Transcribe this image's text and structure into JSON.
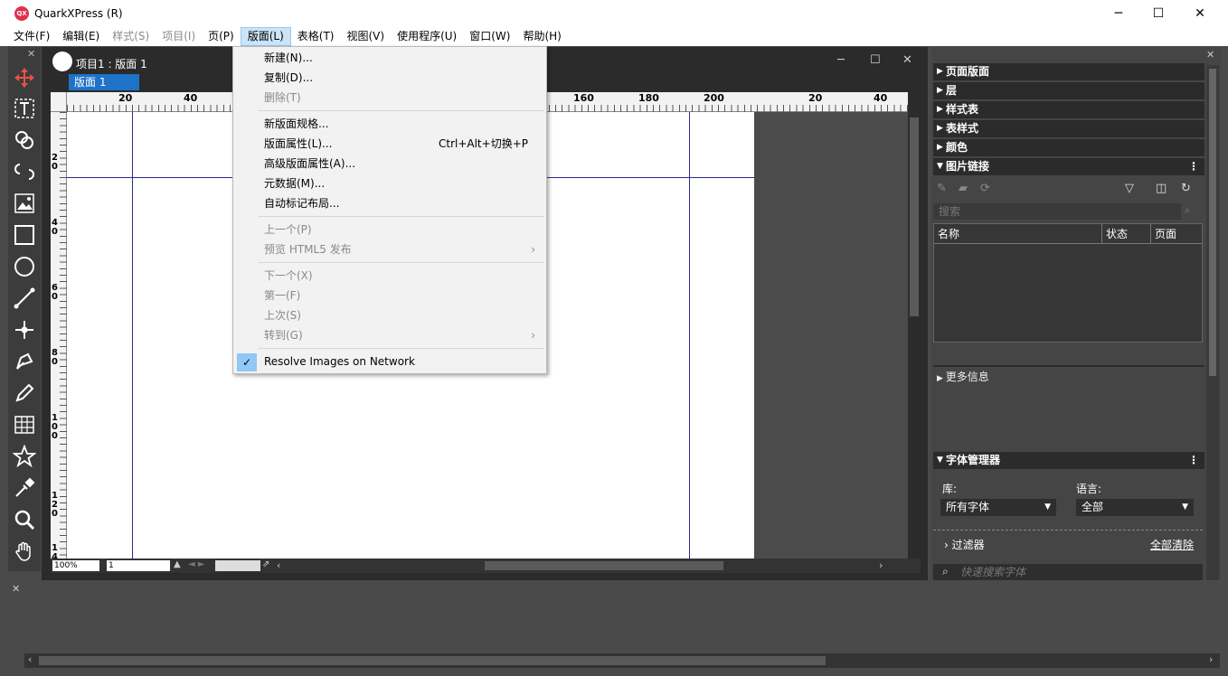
{
  "window": {
    "app_icon_text": "QX",
    "title": "QuarkXPress (R)",
    "minimize": "─",
    "maximize": "☐",
    "close": "✕"
  },
  "menubar": [
    "文件(F)",
    "编辑(E)",
    "样式(S)",
    "项目(I)",
    "页(P)",
    "版面(L)",
    "表格(T)",
    "视图(V)",
    "使用程序(U)",
    "窗口(W)",
    "帮助(H)"
  ],
  "menubar_disabled": [
    2,
    3
  ],
  "menubar_active": 5,
  "document": {
    "title": "项目1 : 版面 1",
    "layout_tab": "版面 1",
    "ruler_top_labels": [
      "20",
      "40",
      "160",
      "180",
      "200",
      "20",
      "40"
    ],
    "ruler_left_labels": [
      "2\n0",
      "4\n0",
      "6\n0",
      "8\n0",
      "1\n0\n0",
      "1\n2\n0",
      "1\n4"
    ],
    "zoom": "100%",
    "page_number": "1"
  },
  "dropdown": {
    "items": [
      {
        "label": "新建(N)...",
        "enabled": true
      },
      {
        "label": "复制(D)...",
        "enabled": true
      },
      {
        "label": "删除(T)",
        "enabled": false
      },
      {
        "label": "新版面规格...",
        "enabled": true
      },
      {
        "label": "版面属性(L)...",
        "enabled": true,
        "shortcut": "Ctrl+Alt+切换+P"
      },
      {
        "label": "高级版面属性(A)...",
        "enabled": true
      },
      {
        "label": "元数据(M)...",
        "enabled": true
      },
      {
        "label": "自动标记布局...",
        "enabled": true
      },
      {
        "label": "上一个(P)",
        "enabled": false
      },
      {
        "label": "预览 HTML5 发布",
        "enabled": false,
        "submenu": true
      },
      {
        "label": "下一个(X)",
        "enabled": false
      },
      {
        "label": "第一(F)",
        "enabled": false
      },
      {
        "label": "上次(S)",
        "enabled": false
      },
      {
        "label": "转到(G)",
        "enabled": false,
        "submenu": true
      },
      {
        "label": "Resolve Images on Network",
        "enabled": true,
        "checked": true
      }
    ],
    "submenu_arrow": "›",
    "check": "✓"
  },
  "right_panel": {
    "sections": [
      "页面版面",
      "层",
      "样式表",
      "表样式",
      "颜色"
    ],
    "picture_links": {
      "title": "图片链接",
      "search_placeholder": "搜索",
      "columns": [
        "名称",
        "状态",
        "页面"
      ]
    },
    "more_info": "更多信息",
    "font_manager": {
      "title": "字体管理器",
      "library_label": "库:",
      "library_value": "所有字体",
      "language_label": "语言:",
      "language_value": "全部",
      "filter_label": "过滤器",
      "clear_all": "全部清除",
      "search_placeholder": "快速搜索字体"
    }
  },
  "colors": {
    "menu_highlight": "#cce4f7",
    "tab_blue": "#1e72c8",
    "panel_dark": "#2b2b2b",
    "margin_guide": "#2a2a8c",
    "tool_active": "#e8504a"
  }
}
